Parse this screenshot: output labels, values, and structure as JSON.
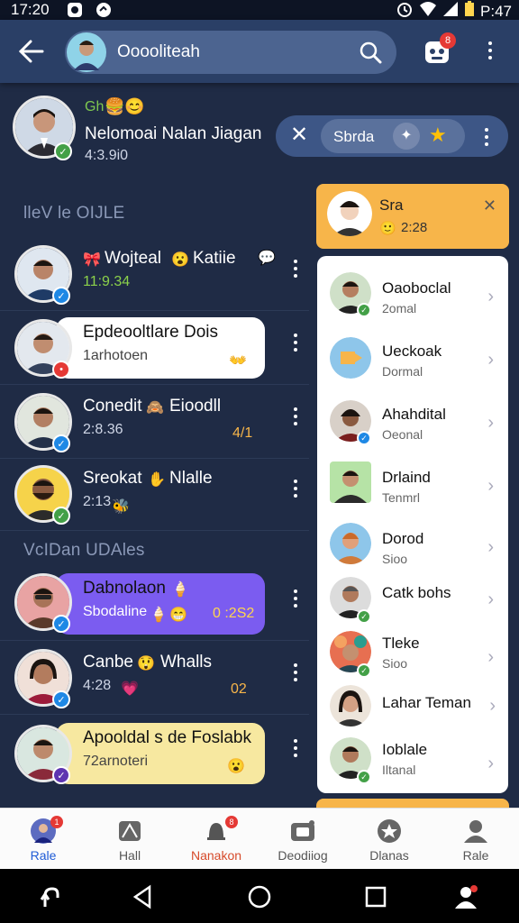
{
  "status": {
    "time": "17:20",
    "right_text": "P:47"
  },
  "appbar": {
    "title": "Ooooliteah"
  },
  "profile": {
    "emoji_line": "Gh",
    "name": "Nelomoai Nalan Jiagan",
    "sub": "4:3.9i0"
  },
  "filter_chip": {
    "label": "Sbrda"
  },
  "sections": {
    "recent": "lleV le OIJLE",
    "updates": "VcIDan UDAles"
  },
  "chats": [
    {
      "name": "Wojteal",
      "name2": "Katiie",
      "sub": "11:9.34"
    },
    {
      "name": "Epdeooltlare Dois",
      "sub": "1arhotoen"
    },
    {
      "name": "Conedit",
      "name2": "Eioodll",
      "sub": "2:8.36",
      "tail": "4/1"
    },
    {
      "name": "Sreokat",
      "name2": "Nlalle",
      "sub": "2:13"
    },
    {
      "name": "Dabnolaon",
      "sub": "Sbodaline",
      "tail": "0 :2S2"
    },
    {
      "name": "Canbe",
      "name2": "Whalls",
      "sub": "4:28",
      "tail": "02"
    },
    {
      "name": "Apooldal s de Foslabk",
      "sub": "72arnoteri"
    }
  ],
  "featured": {
    "name": "Sra",
    "sub": "2:28"
  },
  "contacts": [
    {
      "name": "Oaoboclal",
      "sub": "2omal"
    },
    {
      "name": "Ueckoak",
      "sub": "Dormal"
    },
    {
      "name": "Ahahdital",
      "sub": "Oeonal"
    },
    {
      "name": "Drlaind",
      "sub": "Tenmrl"
    },
    {
      "name": "Dorod",
      "sub": "Sioo"
    },
    {
      "name": "Catk bohs",
      "sub": ""
    },
    {
      "name": "Tleke",
      "sub": "Sioo"
    },
    {
      "name": "Lahar Teman",
      "sub": ""
    },
    {
      "name": "Ioblale",
      "sub": "Iltanal"
    }
  ],
  "bottom_nav": [
    {
      "label": "Rale",
      "color": "#1e5bd6"
    },
    {
      "label": "Hall",
      "color": "#555555"
    },
    {
      "label": "Nanakon",
      "color": "#d64a2a"
    },
    {
      "label": "Deodiiog",
      "color": "#555555"
    },
    {
      "label": "Dlanas",
      "color": "#555555"
    },
    {
      "label": "Rale",
      "color": "#555555"
    }
  ]
}
